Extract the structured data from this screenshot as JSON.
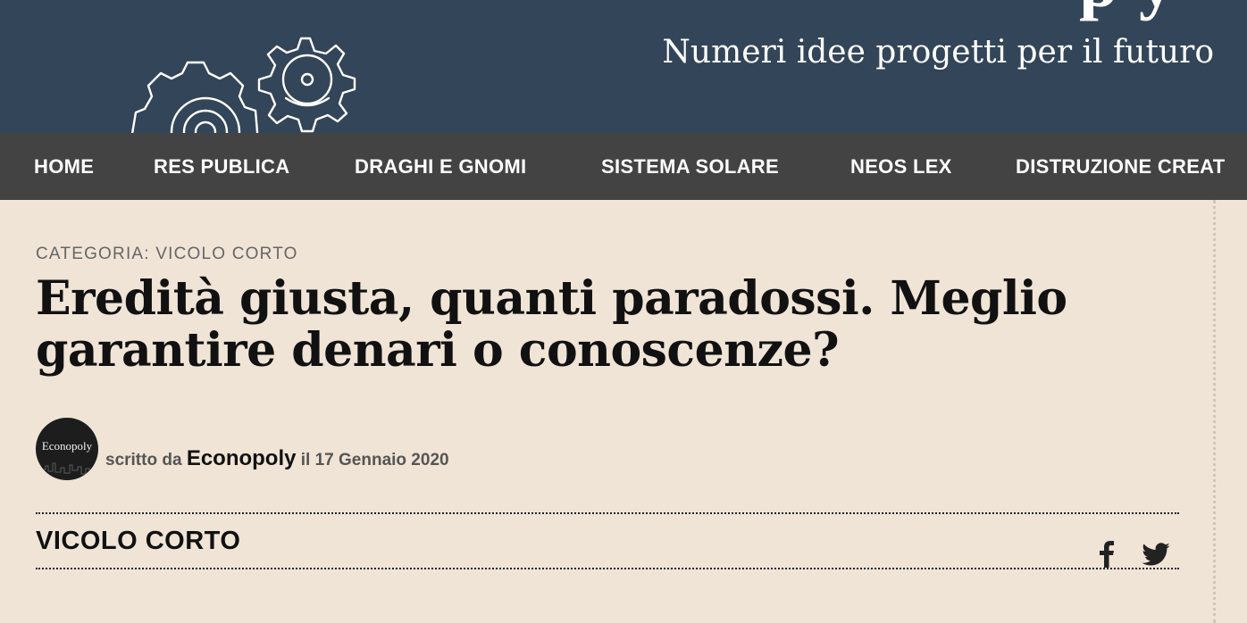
{
  "header": {
    "logo_fragment": "p y",
    "tagline": "Numeri idee progetti per il futuro",
    "icon": "gears-icon"
  },
  "nav": {
    "items": [
      {
        "label": "HOME"
      },
      {
        "label": "RES PUBLICA"
      },
      {
        "label": "DRAGHI E GNOMI"
      },
      {
        "label": "SISTEMA SOLARE"
      },
      {
        "label": "NEOS LEX"
      },
      {
        "label": "DISTRUZIONE CREAT"
      }
    ]
  },
  "article": {
    "category_prefix": "CATEGORIA: ",
    "category": "VICOLO CORTO",
    "title": "Eredità giusta, quanti paradossi. Meglio garantire denari o conoscenze?",
    "avatar_text": "Econopoly",
    "byline_prefix": "scritto da ",
    "author": "Econopoly",
    "date_prefix": " il ",
    "date": "17 Gennaio 2020"
  },
  "section": {
    "title": "VICOLO CORTO"
  },
  "social": {
    "icons": [
      "facebook-icon",
      "twitter-icon"
    ]
  },
  "colors": {
    "header_bg": "#334558",
    "nav_bg": "#434343",
    "page_bg": "#f0e4d6"
  }
}
